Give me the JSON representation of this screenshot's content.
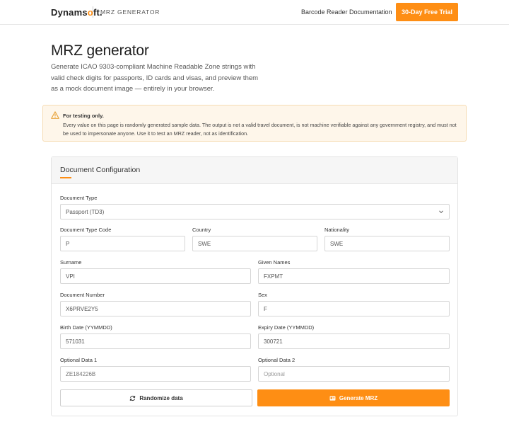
{
  "header": {
    "logo_main": "Dynams",
    "logo_accent": "o",
    "logo_tail": "ft.",
    "app_name": "MRZ GENERATOR",
    "nav": [
      "Barcode Reader",
      "Documentation"
    ],
    "cta": "30-Day Free Trial"
  },
  "hero": {
    "title": "MRZ generator",
    "description": "Generate ICAO 9303-compliant Machine Readable Zone strings with valid check digits for passports, ID cards and visas, and preview them as a mock document image — entirely in your browser."
  },
  "warning": {
    "title": "For testing only.",
    "body": "Every value on this page is randomly generated sample data. The output is not a valid travel document, is not machine verifiable against any government registry, and must not be used to impersonate anyone. Use it to test an MRZ reader, not as identification."
  },
  "form": {
    "title": "Document Configuration",
    "document_type": {
      "label": "Document Type",
      "value": "Passport (TD3)"
    },
    "document_type_code": {
      "label": "Document Type Code",
      "value": "P"
    },
    "country": {
      "label": "Country",
      "value": "SWE"
    },
    "nationality": {
      "label": "Nationality",
      "value": "SWE"
    },
    "surname": {
      "label": "Surname",
      "value": "VPI"
    },
    "given_names": {
      "label": "Given Names",
      "value": "FXPMT"
    },
    "document_number": {
      "label": "Document Number",
      "value": "X6PRVE2Y5"
    },
    "sex": {
      "label": "Sex",
      "value": "F"
    },
    "birth_date": {
      "label": "Birth Date (YYMMDD)",
      "value": "571031"
    },
    "expiry_date": {
      "label": "Expiry Date (YYMMDD)",
      "value": "300721"
    },
    "optional_data_1": {
      "label": "Optional Data 1",
      "value": "ZE184226B"
    },
    "optional_data_2": {
      "label": "Optional Data 2",
      "placeholder": "Optional"
    },
    "randomize_label": "Randomize data",
    "generate_label": "Generate MRZ"
  },
  "colors": {
    "accent": "#fe8e14",
    "warning_bg": "#fef6ea"
  }
}
